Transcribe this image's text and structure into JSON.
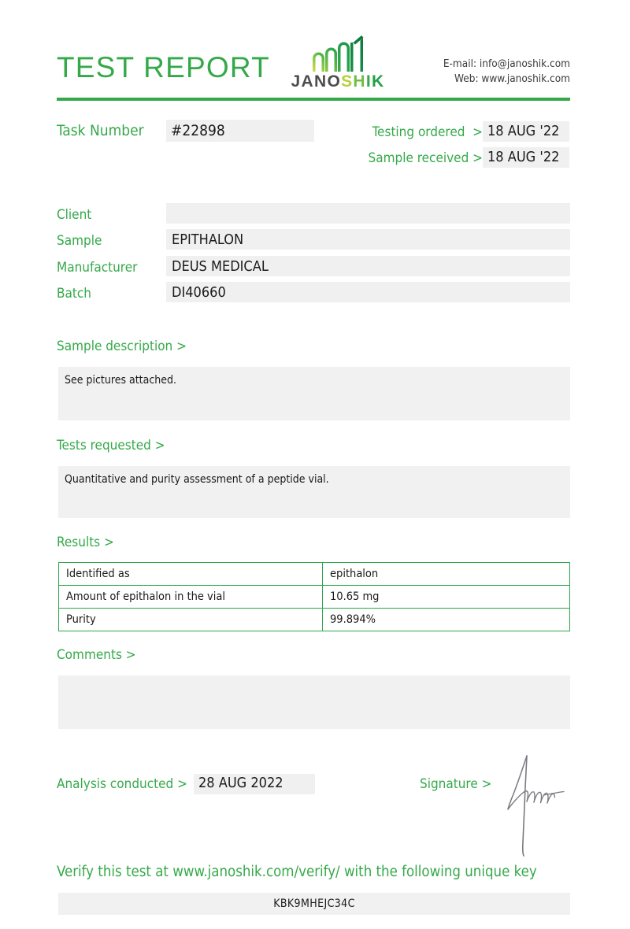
{
  "document": {
    "title": "TEST REPORT",
    "brand": {
      "name_parts": [
        "JANO",
        "S",
        "H",
        "I",
        "K"
      ],
      "logo_icon": "janoshik-bars-logo",
      "accent_color": "#35a94a"
    },
    "contact": {
      "email_line": "E-mail: info@janoshik.com",
      "web_line": "Web: www.janoshik.com"
    }
  },
  "task": {
    "label": "Task Number",
    "value": "#22898"
  },
  "dates": {
    "testing_ordered": {
      "label": "Testing ordered",
      "separator": ">",
      "value": "18 AUG '22"
    },
    "sample_received": {
      "label": "Sample received",
      "separator": ">",
      "value": "18 AUG '22"
    }
  },
  "fields": [
    {
      "label": "Client",
      "value": ""
    },
    {
      "label": "Sample",
      "value": "EPITHALON"
    },
    {
      "label": "Manufacturer",
      "value": "DEUS MEDICAL"
    },
    {
      "label": "Batch",
      "value": "DI40660"
    }
  ],
  "sections": {
    "sample_description": {
      "heading": "Sample description >",
      "text": "See pictures attached."
    },
    "tests_requested": {
      "heading": "Tests requested >",
      "text": "Quantitative and purity assessment of a peptide vial."
    },
    "results": {
      "heading": "Results >"
    },
    "comments": {
      "heading": "Comments >",
      "text": ""
    }
  },
  "results_table": {
    "rows": [
      {
        "parameter": "Identified as",
        "result": "epithalon"
      },
      {
        "parameter": "Amount of epithalon in the vial",
        "result": "10.65 mg"
      },
      {
        "parameter": "Purity",
        "result": "99.894%"
      }
    ]
  },
  "analysis": {
    "label": "Analysis conducted >",
    "date": "28 AUG 2022"
  },
  "signature": {
    "label": "Signature >",
    "icon": "handwritten-signature"
  },
  "footer": {
    "verify_text": "Verify this test at www.janoshik.com/verify/ with the following unique key",
    "unique_key": "KBK9MHEJC34C"
  }
}
